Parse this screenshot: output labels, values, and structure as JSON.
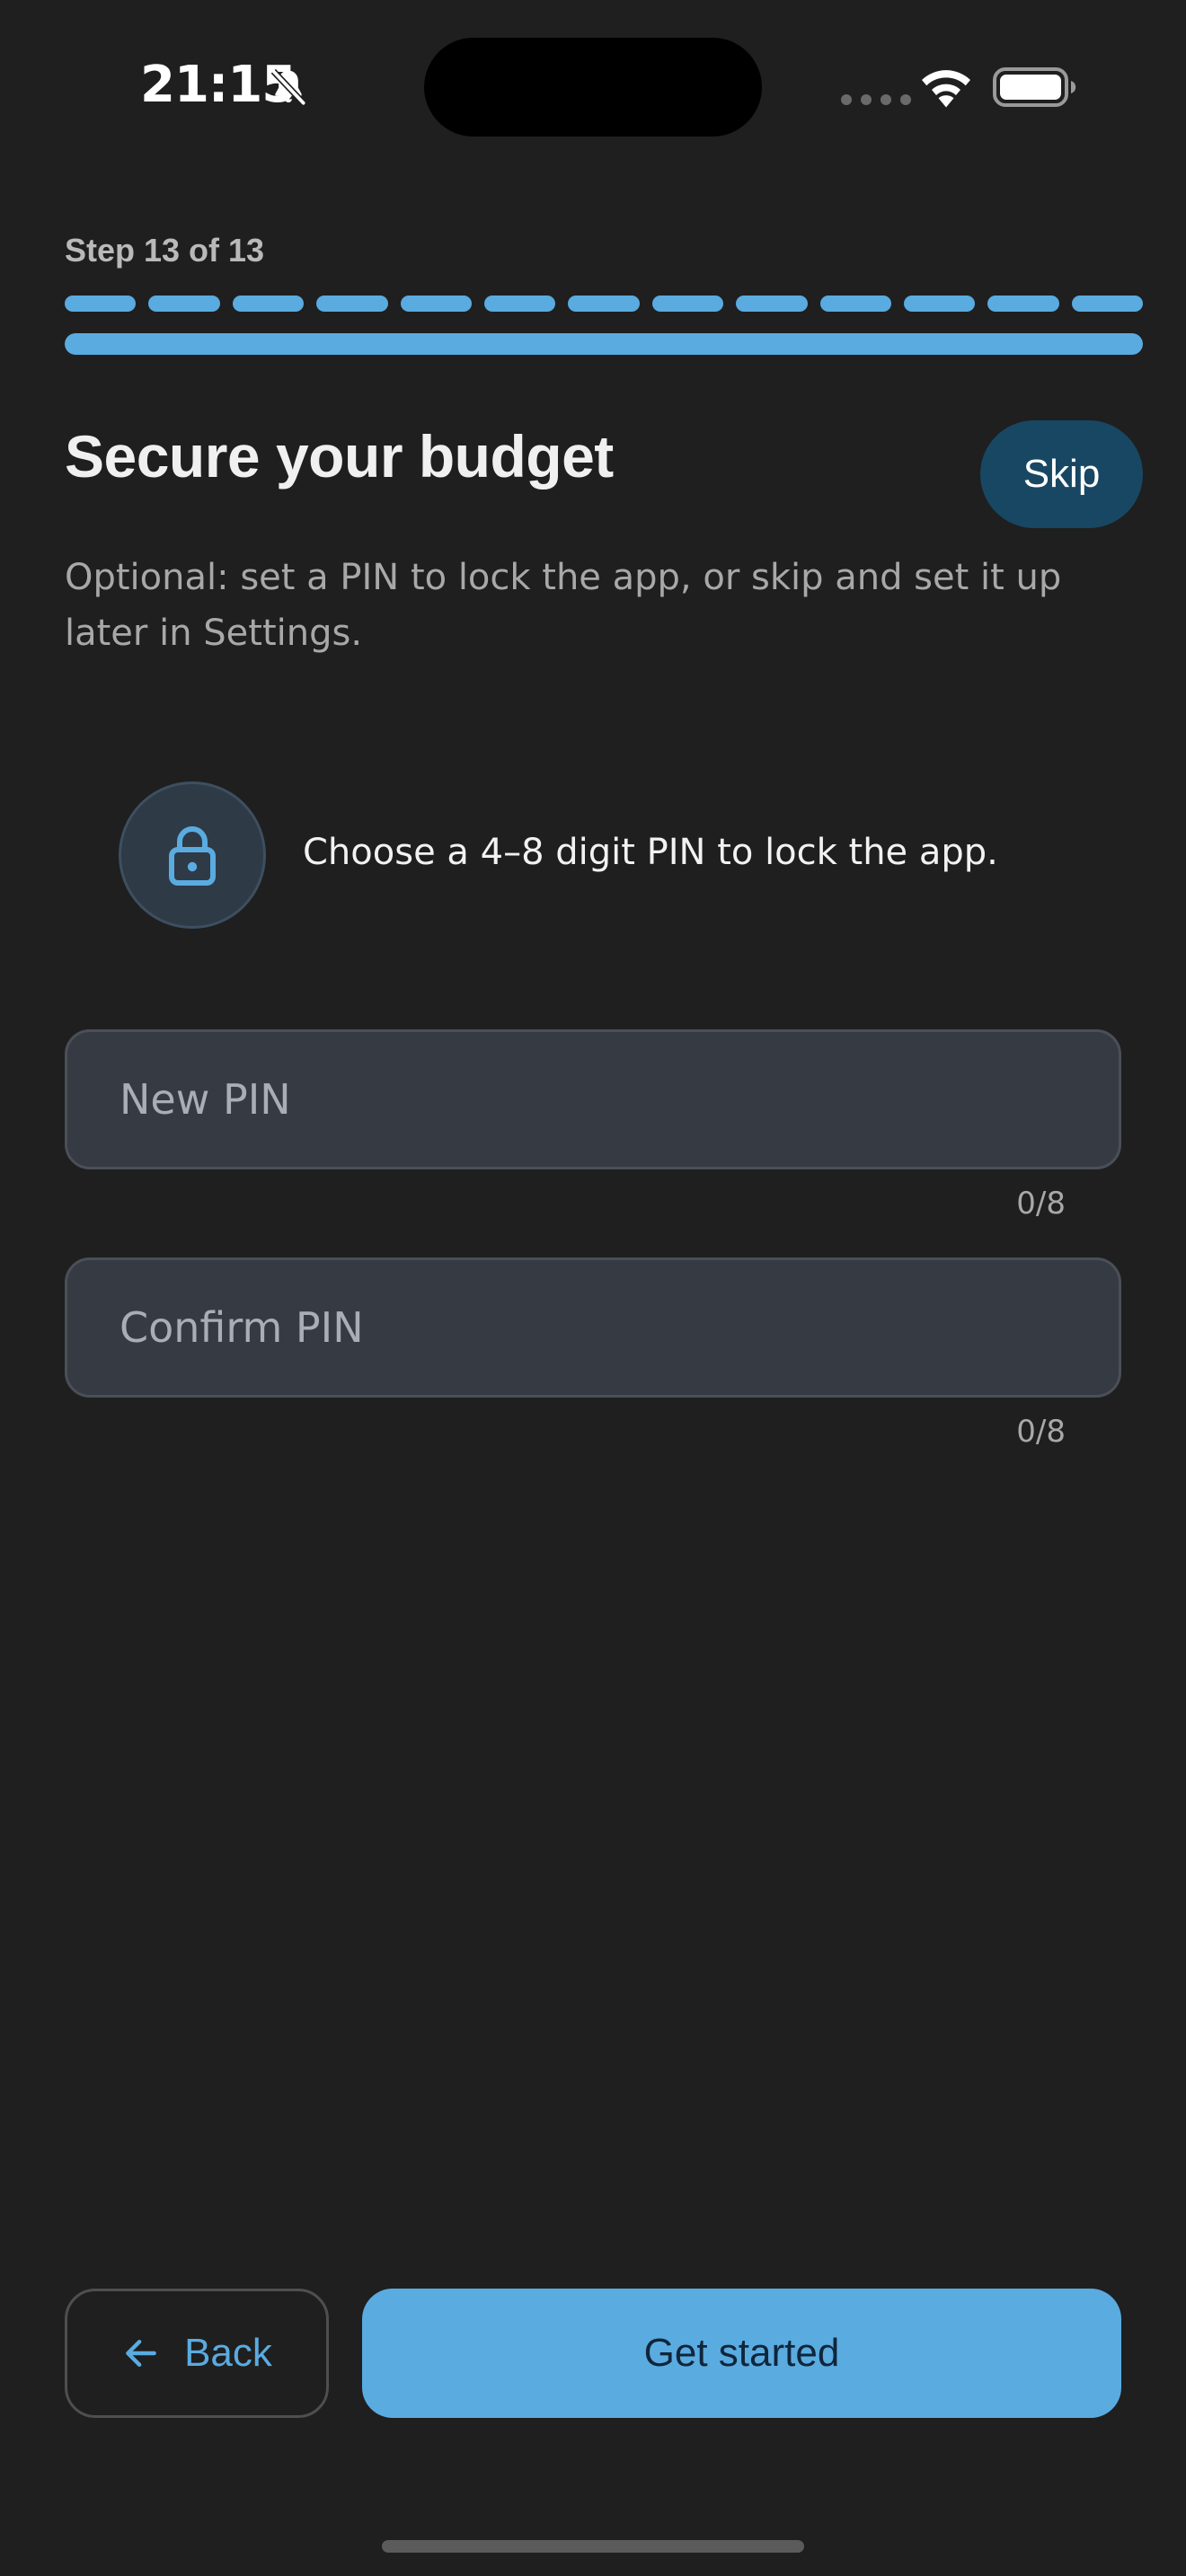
{
  "status_bar": {
    "time": "21:15",
    "icons": [
      "bell-off-icon",
      "signal-dots-icon",
      "wifi-icon",
      "battery-icon"
    ]
  },
  "progress": {
    "step_label": "Step 13 of 13",
    "current_step": 13,
    "total_steps": 13,
    "fraction_complete": 1.0
  },
  "header": {
    "title": "Secure your budget",
    "skip_label": "Skip",
    "subtitle": "Optional: set a PIN to lock the app, or skip and set it up later in Settings."
  },
  "lock_info": {
    "icon": "lock-icon",
    "text": "Choose a 4–8 digit PIN to lock the app."
  },
  "form": {
    "new_pin": {
      "value": "",
      "placeholder": "New PIN",
      "counter": "0/8"
    },
    "confirm_pin": {
      "value": "",
      "placeholder": "Confirm PIN",
      "counter": "0/8"
    }
  },
  "footer": {
    "back_label": "Back",
    "primary_label": "Get started"
  },
  "colors": {
    "background": "#1f1f1f",
    "accent": "#5aabe0",
    "skip_background": "#184763",
    "field_background": "#363a43",
    "muted_text": "#a8a8a8"
  }
}
